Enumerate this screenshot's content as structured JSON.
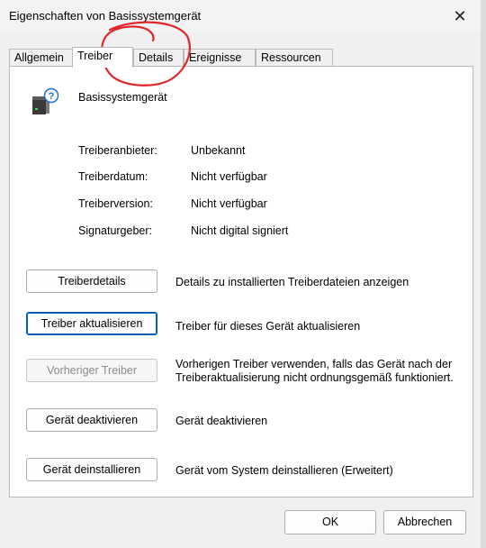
{
  "window": {
    "title": "Eigenschaften von Basissystemgerät",
    "close_glyph": "✕"
  },
  "tabs": [
    {
      "label": "Allgemein",
      "active": false
    },
    {
      "label": "Treiber",
      "active": true
    },
    {
      "label": "Details",
      "active": false
    },
    {
      "label": "Ereignisse",
      "active": false
    },
    {
      "label": "Ressourcen",
      "active": false
    }
  ],
  "device": {
    "name": "Basissystemgerät",
    "icon": "unknown-device-icon"
  },
  "driver_info": [
    {
      "label": "Treiberanbieter:",
      "value": "Unbekannt"
    },
    {
      "label": "Treiberdatum:",
      "value": "Nicht verfügbar"
    },
    {
      "label": "Treiberversion:",
      "value": "Nicht verfügbar"
    },
    {
      "label": "Signaturgeber:",
      "value": "Nicht digital signiert"
    }
  ],
  "actions": [
    {
      "button": "Treiberdetails",
      "description": "Details zu installierten Treiberdateien anzeigen",
      "enabled": true
    },
    {
      "button": "Treiber aktualisieren",
      "description": "Treiber für dieses Gerät aktualisieren",
      "enabled": true,
      "focused": true
    },
    {
      "button": "Vorheriger Treiber",
      "description": "Vorherigen Treiber verwenden, falls das Gerät nach der Treiberaktualisierung nicht ordnungsgemäß funktioniert.",
      "enabled": false
    },
    {
      "button": "Gerät deaktivieren",
      "description": "Gerät deaktivieren",
      "enabled": true
    },
    {
      "button": "Gerät deinstallieren",
      "description": "Gerät vom System deinstallieren (Erweitert)",
      "enabled": true
    }
  ],
  "footer": {
    "ok_label": "OK",
    "cancel_label": "Abbrechen"
  },
  "colors": {
    "accent": "#005fb8",
    "annotation": "#e0262b"
  }
}
